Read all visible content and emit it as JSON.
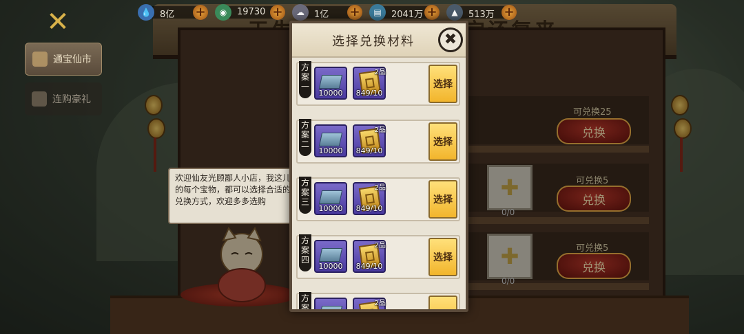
{
  "resources": [
    {
      "icon": "water-drop-icon",
      "value": "8亿",
      "color": "#3a6fb0"
    },
    {
      "icon": "jade-coin-icon",
      "value": "19730",
      "color": "#3a8a5a"
    },
    {
      "icon": "cloud-icon",
      "value": "1亿",
      "color": "#6a6a7a"
    },
    {
      "icon": "scroll-book-icon",
      "value": "2041万",
      "color": "#3a7a9a"
    },
    {
      "icon": "bell-icon",
      "value": "513万",
      "color": "#4a5a6a"
    }
  ],
  "sidebar": {
    "items": [
      {
        "label": "通宝仙市",
        "active": true
      },
      {
        "label": "连购豪礼",
        "active": false
      }
    ]
  },
  "roof_title": {
    "left": "天生",
    "right": "宝还复来"
  },
  "shop": {
    "rows": [
      {
        "can_exchange": "可兑换25",
        "button": "兑换",
        "slot_count": ""
      },
      {
        "can_exchange": "可兑换5",
        "button": "兑换",
        "slot_count": "0/0"
      },
      {
        "can_exchange": "可兑换5",
        "button": "兑换",
        "slot_count": "0/0"
      }
    ]
  },
  "npc_speech": "欢迎仙友光顾鄙人小店，我这儿的每个宝物，都可以选择合适的兑换方式，欢迎多多选购",
  "modal": {
    "title": "选择兑换材料",
    "close": "✖",
    "plans": [
      {
        "label": "方案一",
        "ingot_qty": "10000",
        "token_qty": "849/10",
        "token_badge": "2品",
        "button": "选择"
      },
      {
        "label": "方案二",
        "ingot_qty": "10000",
        "token_qty": "849/10",
        "token_badge": "2品",
        "button": "选择"
      },
      {
        "label": "方案三",
        "ingot_qty": "10000",
        "token_qty": "849/10",
        "token_badge": "2品",
        "button": "选择"
      },
      {
        "label": "方案四",
        "ingot_qty": "10000",
        "token_qty": "849/10",
        "token_badge": "2品",
        "button": "选择"
      },
      {
        "label": "方案",
        "ingot_qty": "",
        "token_qty": "",
        "token_badge": "2品",
        "button": ""
      }
    ]
  }
}
